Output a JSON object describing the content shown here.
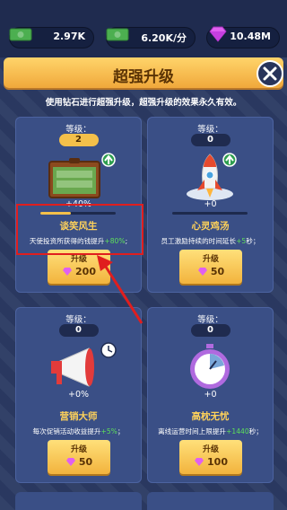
{
  "resources": {
    "cash": "2.97K",
    "income_rate": "6.20K/分",
    "diamonds": "10.48M"
  },
  "panel": {
    "title": "超强升级",
    "description": "使用钻石进行超强升级，超强升级的效果永久有效。"
  },
  "cards": [
    {
      "level_label": "等级：",
      "level": "2",
      "percent": "+40%",
      "progress": 0.4,
      "name": "谈笑风生",
      "info_prefix": "天使投资所获得的钱提升",
      "info_highlight": "+80%",
      "info_suffix": ";",
      "button_label": "升级",
      "cost": "200",
      "icon": "money-suitcase-icon"
    },
    {
      "level_label": "等级：",
      "level": "0",
      "percent": "+0",
      "progress": 0,
      "name": "心灵鸡汤",
      "info_prefix": "员工激励持续的时间延长",
      "info_highlight": "+5",
      "info_suffix": "秒；",
      "button_label": "升级",
      "cost": "50",
      "icon": "rocket-icon"
    },
    {
      "level_label": "等级：",
      "level": "0",
      "percent": "+0%",
      "progress": 0,
      "name": "营销大师",
      "info_prefix": "每次促销活动收益提升",
      "info_highlight": "+5%",
      "info_suffix": "；",
      "button_label": "升级",
      "cost": "50",
      "icon": "megaphone-icon"
    },
    {
      "level_label": "等级：",
      "level": "0",
      "percent": "+0",
      "progress": 0,
      "name": "高枕无忧",
      "info_prefix": "离线运营时间上限提升",
      "info_highlight": "+1440",
      "info_suffix": "秒；",
      "button_label": "升级",
      "cost": "100",
      "icon": "stopwatch-icon"
    }
  ],
  "colors": {
    "accent_gold": "#f4c04a",
    "highlight_green": "#5ee05a",
    "annotation_red": "#e01e1e"
  }
}
